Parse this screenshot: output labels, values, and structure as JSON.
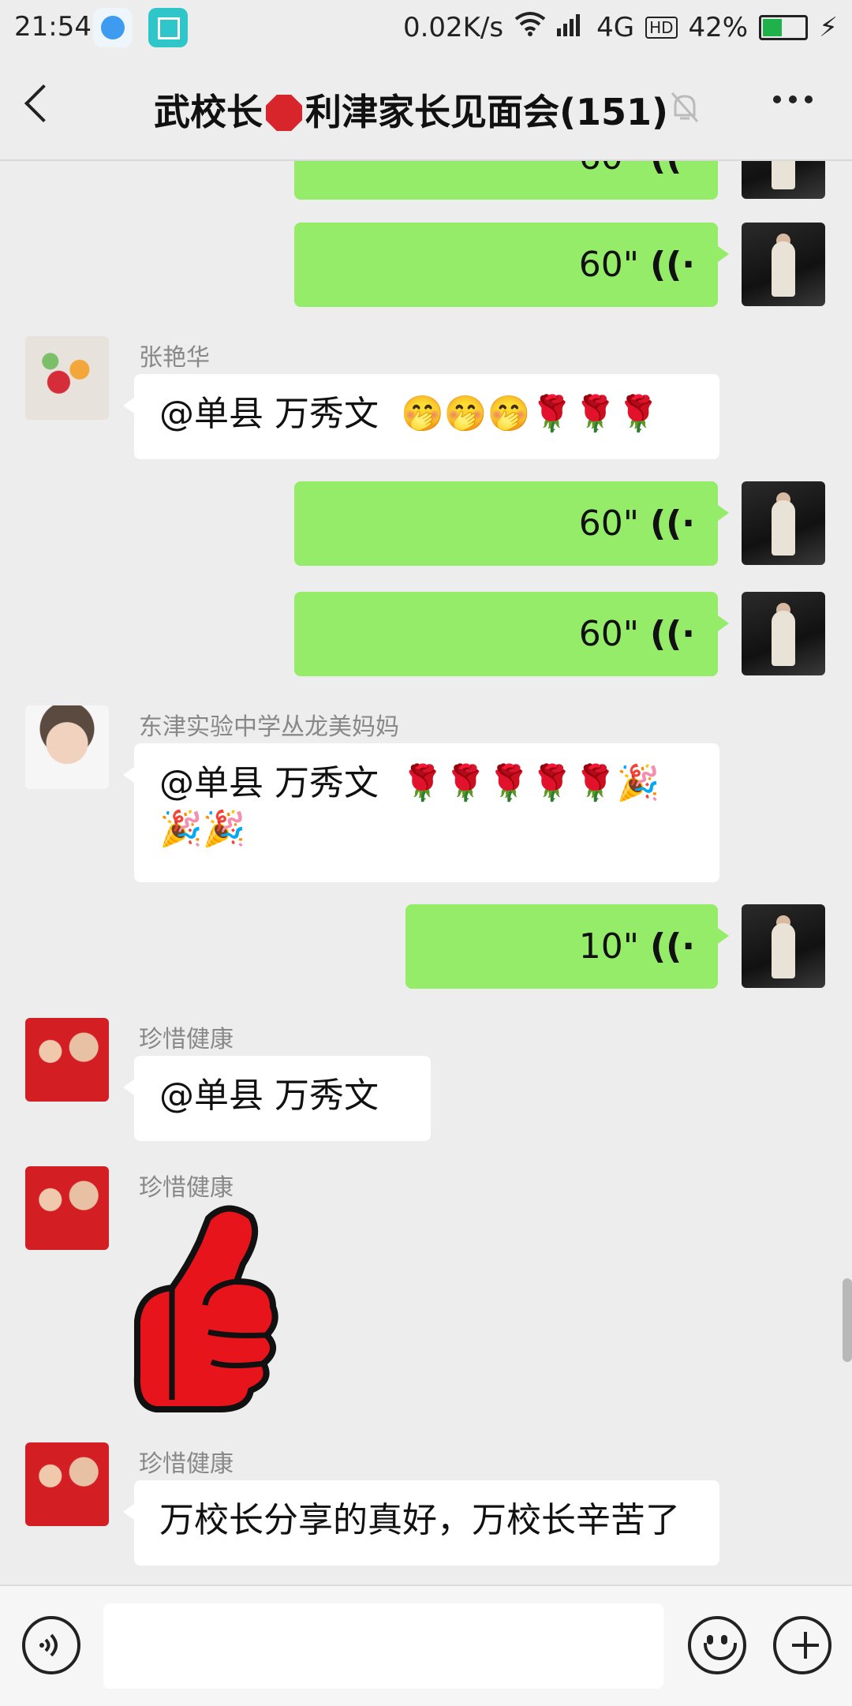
{
  "status_bar": {
    "time": "21:54",
    "network_speed": "0.02K/s",
    "network_type": "4G",
    "hd_label": "HD",
    "battery": "42%",
    "battery_level": 0.42
  },
  "header": {
    "title_part1": "武校长",
    "title_part2": "利津家长见面会(151)"
  },
  "messages": [
    {
      "type": "voice",
      "side": "out",
      "duration": "60\""
    },
    {
      "type": "voice",
      "side": "out",
      "duration": "60\""
    },
    {
      "type": "text",
      "side": "in",
      "sender": "张艳华",
      "text": "@单县  万秀文",
      "emoji": "🤭🤭🤭🌹🌹🌹"
    },
    {
      "type": "voice",
      "side": "out",
      "duration": "60\""
    },
    {
      "type": "voice",
      "side": "out",
      "duration": "60\""
    },
    {
      "type": "text",
      "side": "in",
      "sender": "东津实验中学丛龙美妈妈",
      "text": "@单县  万秀文",
      "emoji": "🌹🌹🌹🌹🌹🎉",
      "emoji2": "🎉🎉"
    },
    {
      "type": "voice",
      "side": "out",
      "duration": "10\""
    },
    {
      "type": "text",
      "side": "in",
      "sender": "珍惜健康",
      "text": "@单县  万秀文"
    },
    {
      "type": "sticker",
      "side": "in",
      "sender": "珍惜健康",
      "sticker": "thumbs-up"
    },
    {
      "type": "text",
      "side": "in",
      "sender": "珍惜健康",
      "text": "万校长分享的真好，万校长辛苦了"
    }
  ],
  "colors": {
    "outgoing_bubble": "#95ec69",
    "incoming_bubble": "#ffffff",
    "background": "#ededed",
    "sticker_red": "#e8141b"
  },
  "icons": {
    "back": "chevron-left-icon",
    "mute": "bell-off-icon",
    "more": "more-horizontal-icon",
    "voice_input": "voice-icon",
    "emoji": "smile-icon",
    "plus": "plus-icon"
  }
}
